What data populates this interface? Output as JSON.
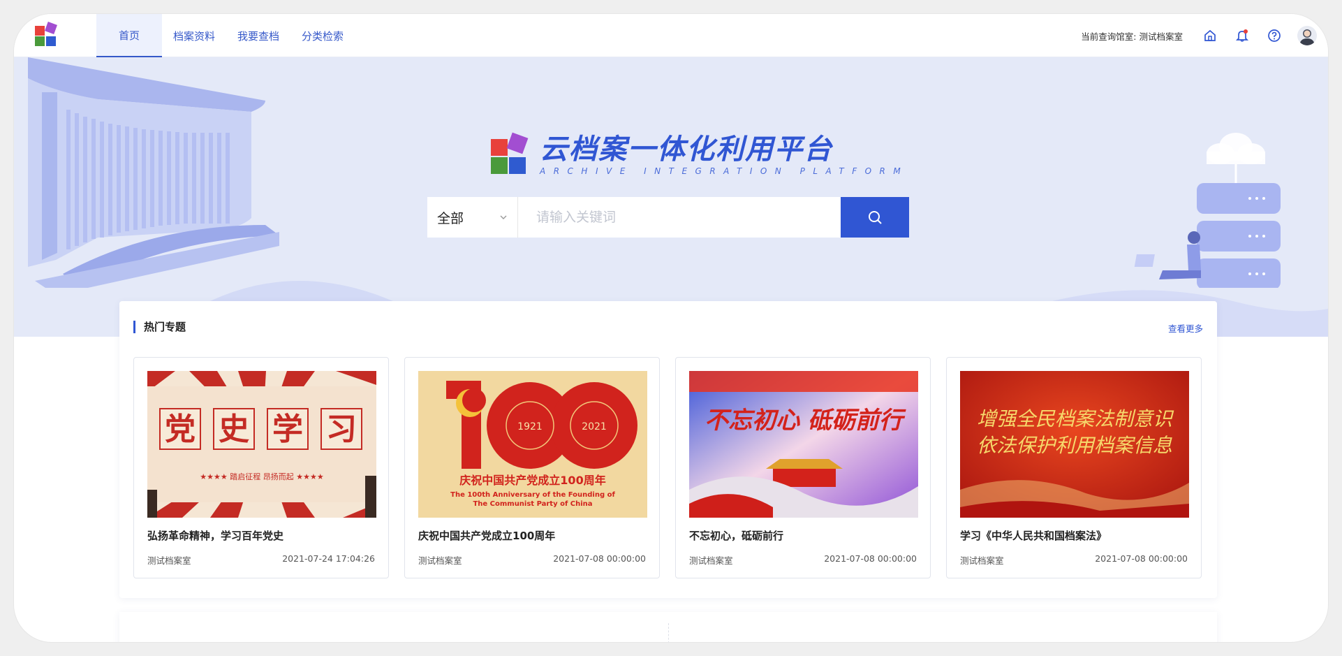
{
  "nav": {
    "tabs": [
      "首页",
      "档案资料",
      "我要查档",
      "分类检索"
    ],
    "room_label": "当前查询馆室:",
    "room_value": "测试档案室"
  },
  "hero": {
    "title": "云档案一体化利用平台",
    "subtitle": "ARCHIVE INTEGRATION PLATFORM"
  },
  "search": {
    "select_value": "全部",
    "placeholder": "请输入关键词"
  },
  "hot": {
    "title": "热门专题",
    "more": "查看更多",
    "cards": [
      {
        "title": "弘扬革命精神，学习百年党史",
        "owner": "测试档案室",
        "date": "2021-07-24 17:04:26",
        "img_text": [
          "党",
          "史",
          "学",
          "习"
        ],
        "img_caption": "★★★★ 踏启征程 昂扬而起 ★★★★"
      },
      {
        "title": "庆祝中国共产党成立100周年",
        "owner": "测试档案室",
        "date": "2021-07-08 00:00:00",
        "img_years": [
          "1921",
          "2021"
        ],
        "img_caption": "庆祝中国共产党成立100周年",
        "img_caption_en_1": "The 100th Anniversary of the Founding of",
        "img_caption_en_2": "The Communist Party of China"
      },
      {
        "title": "不忘初心，砥砺前行",
        "owner": "测试档案室",
        "date": "2021-07-08 00:00:00",
        "img_caption": "不忘初心 砥砺前行"
      },
      {
        "title": "学习《中华人民共和国档案法》",
        "owner": "测试档案室",
        "date": "2021-07-08 00:00:00",
        "img_line1": "增强全民档案法制意识",
        "img_line2": "依法保护利用档案信息"
      }
    ]
  },
  "colors": {
    "accent": "#3056d3",
    "hero_bg": "#e4e9f8"
  },
  "icons": [
    "home-icon",
    "bell-icon",
    "help-icon"
  ]
}
